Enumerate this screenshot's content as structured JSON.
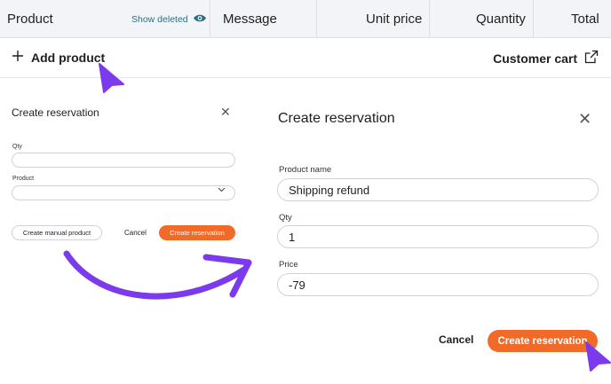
{
  "table_header": {
    "product": "Product",
    "show_deleted": "Show deleted",
    "message": "Message",
    "unit_price": "Unit price",
    "quantity": "Quantity",
    "total": "Total"
  },
  "actions": {
    "add_product": "Add product",
    "customer_cart": "Customer cart"
  },
  "small_dialog": {
    "title": "Create reservation",
    "qty_label": "Qty",
    "product_label": "Product",
    "create_manual_label": "Create manual product",
    "cancel_label": "Cancel",
    "create_reservation_label": "Create reservation"
  },
  "large_dialog": {
    "title": "Create reservation",
    "product_name_label": "Product name",
    "product_name_value": "Shipping refund",
    "qty_label": "Qty",
    "qty_value": "1",
    "price_label": "Price",
    "price_value": "-79",
    "cancel_label": "Cancel",
    "create_reservation_label": "Create reservation"
  },
  "colors": {
    "accent": "#f26a28",
    "annotation": "#7c3aed",
    "link_teal": "#2b6f80"
  },
  "icons": {
    "eye": "eye-icon",
    "plus": "plus-icon",
    "external": "external-link-icon",
    "close": "close-icon",
    "chevron": "chevron-down-icon"
  }
}
